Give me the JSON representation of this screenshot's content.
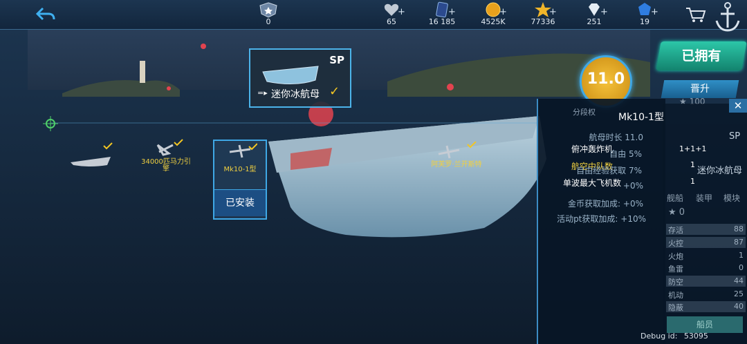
{
  "topbar": {
    "rank_value": "0",
    "resources": [
      {
        "icon": "heart-icon",
        "value": "65"
      },
      {
        "icon": "card-icon",
        "value": "16 185"
      },
      {
        "icon": "gold-coin-icon",
        "value": "4525K"
      },
      {
        "icon": "star-icon",
        "value": "77336"
      },
      {
        "icon": "diamond-icon",
        "value": "251"
      },
      {
        "icon": "blue-gem-icon",
        "value": "19"
      }
    ]
  },
  "ship_card": {
    "grade": "SP",
    "name": "迷你冰航母"
  },
  "level": "11.0",
  "buttons": {
    "owned": "已拥有",
    "promote": "晋升",
    "installed": "已安装",
    "crew": "船员"
  },
  "points_value": "100",
  "aircraft_labels": {
    "a1": "34000匹马力引擎",
    "a2": "Mk10-1型",
    "a3": "阿芙罗·兰开斯特"
  },
  "info_panel": {
    "title": "Mk10-1型",
    "rows": [
      {
        "label": "俯冲轰炸机",
        "value": "1+1+1"
      },
      {
        "label": "航空中队数",
        "value": "1"
      },
      {
        "label": "单波最大飞机数",
        "value": "1"
      }
    ],
    "partial_text": "分段权"
  },
  "bonus_rows": [
    {
      "label": "航母时长",
      "value": "11.0"
    },
    {
      "label": "自由",
      "value": "5%"
    },
    {
      "label": "自由经验获取",
      "value": "7%"
    },
    {
      "label": "",
      "value": "+0%"
    },
    {
      "label": "金币获取加成:",
      "value": "+0%"
    },
    {
      "label": "活动pt获取加成:",
      "value": "+10%"
    }
  ],
  "right_panel": {
    "grade": "SP",
    "ship_name": "迷你冰航母",
    "tabs": [
      "舰船",
      "装甲",
      "模块"
    ],
    "star_value": "0",
    "stats": [
      {
        "label": "存活",
        "value": "88"
      },
      {
        "label": "火控",
        "value": "87"
      },
      {
        "label": "火炮",
        "value": "1"
      },
      {
        "label": "鱼雷",
        "value": "0"
      },
      {
        "label": "防空",
        "value": "44"
      },
      {
        "label": "机动",
        "value": "25"
      },
      {
        "label": "隐蔽",
        "value": "40"
      }
    ]
  },
  "debug": {
    "label": "Debug id:",
    "value": "53095"
  }
}
